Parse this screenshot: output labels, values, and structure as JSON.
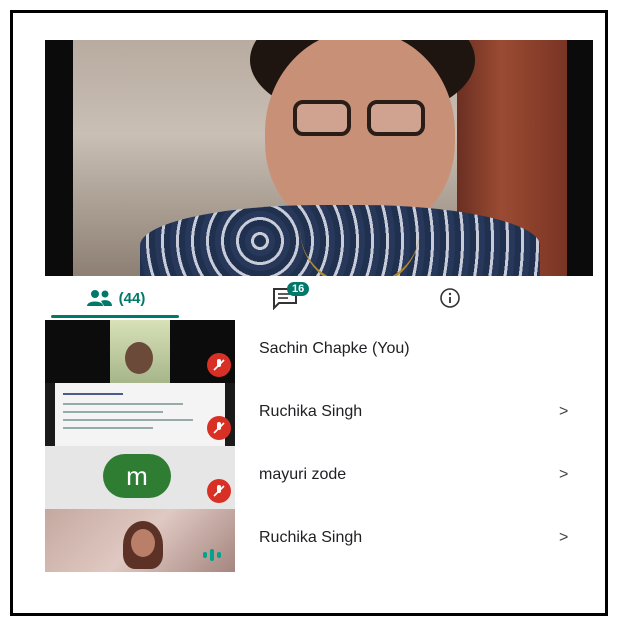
{
  "main_video": {
    "speaker_label": "Active speaker video"
  },
  "tabs": [
    {
      "icon": "people-icon",
      "label": "(44)"
    },
    {
      "icon": "chat-icon",
      "badge": "16"
    },
    {
      "icon": "info-icon"
    }
  ],
  "participants": [
    {
      "name": "Sachin Chapke (You)",
      "chevron": "",
      "audio": "muted"
    },
    {
      "name": "Ruchika Singh",
      "chevron": ">",
      "audio": "muted"
    },
    {
      "name": "mayuri zode",
      "chevron": ">",
      "audio": "muted",
      "avatar_letter": "m"
    },
    {
      "name": "Ruchika Singh",
      "chevron": ">",
      "audio": "speaking"
    }
  ],
  "colors": {
    "accent": "#00796b",
    "muted_red": "#d93025",
    "avatar_green": "#2e7d32"
  }
}
